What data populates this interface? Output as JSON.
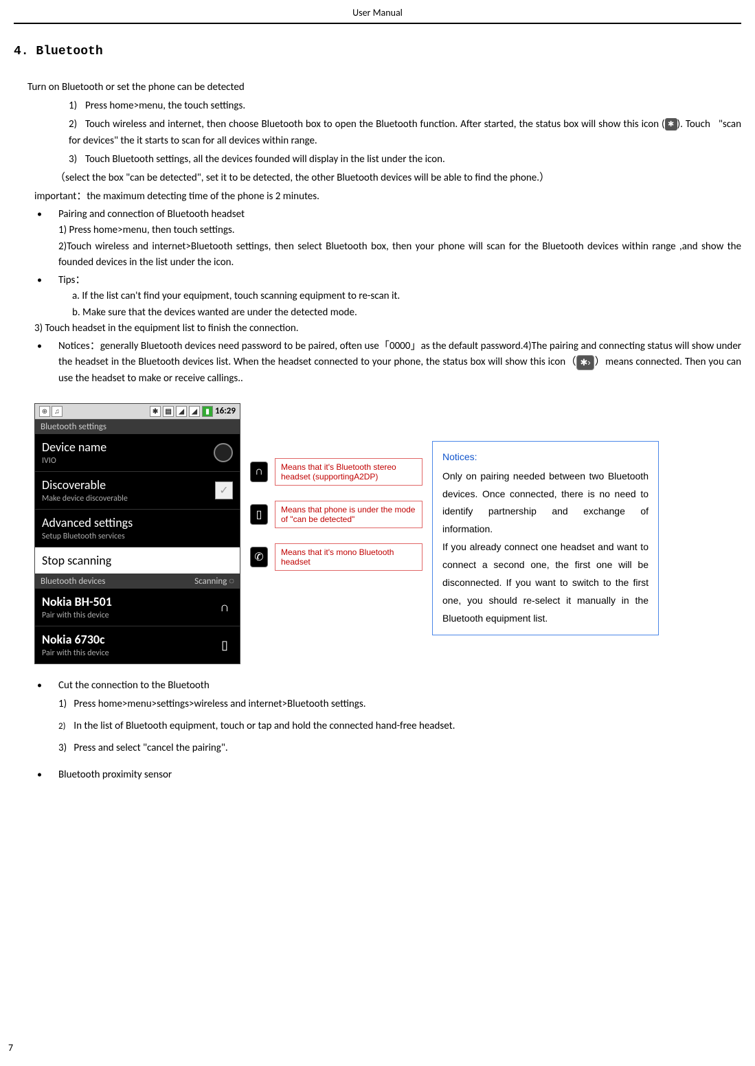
{
  "header": {
    "title": "User Manual"
  },
  "page_number": "7",
  "section": {
    "number": "4.",
    "title": "Bluetooth"
  },
  "intro": "Turn on Bluetooth or set the phone can be detected",
  "steps": [
    "Press home>menu, the touch settings.",
    "Touch wireless and internet, then choose Bluetooth box to open the Bluetooth function. After started, the status box will show this icon (",
    "). Touch   \"scan for devices\" the it starts to scan for all devices within range.",
    "Touch Bluetooth settings, all the devices founded will display in the list under the icon."
  ],
  "select_note": "（select the box \"can be detected\", set it to be detected, the other Bluetooth devices will be able to find the phone.）",
  "important": "important：the maximum detecting time of the phone is 2 minutes.",
  "bullets": {
    "pairing_title": "Pairing and connection of Bluetooth headset",
    "pairing_steps": [
      "1) Press home>menu, then touch settings.",
      "2)Touch wireless and internet>Bluetooth settings, then select Bluetooth box, then your phone will scan for the Bluetooth devices within range ,and show the founded devices in the list under the icon."
    ],
    "tips_title": "Tips：",
    "tips_items": [
      "a.  If the list can't find your equipment, touch scanning equipment to re-scan it.",
      "b.  Make sure that the devices wanted are under the detected mode."
    ],
    "tips_after": "3) Touch headset in the equipment list to finish the connection.",
    "notices_title": "Notices：",
    "notices_body_a": "generally Bluetooth devices need password to be paired, often use「0000」as the default password.4)The pairing and connecting status will show under the headset in the Bluetooth devices list. When the headset connected to your phone, the status box will show this icon（",
    "notices_body_b": "）means connected. Then you can use the headset to make or receive callings.."
  },
  "screenshot": {
    "status_time": "16:29",
    "header": "Bluetooth settings",
    "items": [
      {
        "title": "Device name",
        "sub": "IVIO",
        "ctrl": "radio"
      },
      {
        "title": "Discoverable",
        "sub": "Make device discoverable",
        "ctrl": "check"
      },
      {
        "title": "Advanced settings",
        "sub": "Setup Bluetooth services",
        "ctrl": ""
      },
      {
        "title": "Stop scanning",
        "sub": "",
        "ctrl": ""
      }
    ],
    "devices_header_left": "Bluetooth devices",
    "devices_header_right": "Scanning",
    "devices": [
      {
        "title": "Nokia BH-501",
        "sub": "Pair with this device",
        "icon": "headphones"
      },
      {
        "title": "Nokia 6730c",
        "sub": "Pair with this device",
        "icon": "phone"
      }
    ]
  },
  "callouts": [
    "Means that it's Bluetooth stereo headset (supportingA2DP)",
    "Means that phone is under the mode of \"can be detected\"",
    "Means that it's mono Bluetooth headset"
  ],
  "notices_box": {
    "title": "Notices:",
    "body": "Only on pairing needed between two Bluetooth devices. Once connected, there is no need to identify partnership and exchange of information.\nIf you already connect one headset and want to connect a second one, the first one will be disconnected. If you want to switch to the first one, you should re-select it manually in the Bluetooth equipment list."
  },
  "cut_section": {
    "title": "Cut the connection to the Bluetooth",
    "items": [
      "Press home>menu>settings>wireless and internet>Bluetooth settings.",
      "In the list of Bluetooth equipment, touch or tap and hold the connected hand-free headset.",
      "Press and select \"cancel the pairing\"."
    ]
  },
  "last_bullet": "Bluetooth proximity sensor"
}
